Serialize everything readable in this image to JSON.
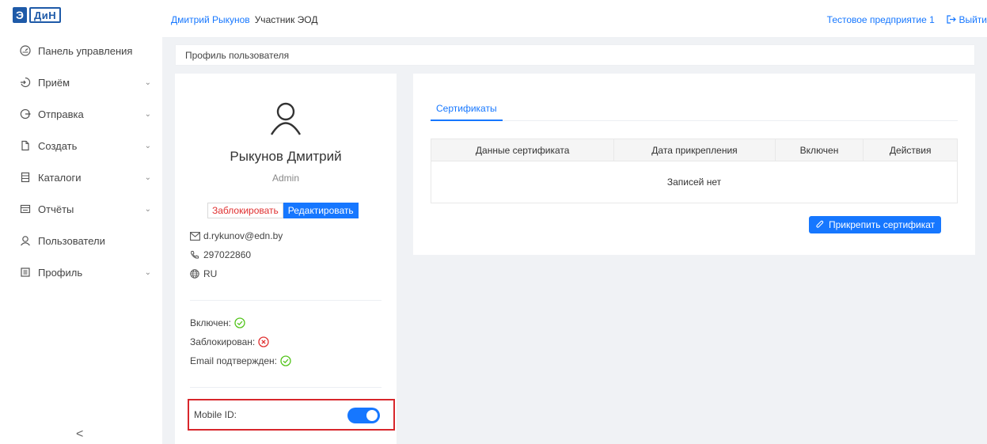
{
  "brand": {
    "logo_e": "Э",
    "logo_din": "ДиН"
  },
  "topbar": {
    "user_name": "Дмитрий Рыкунов",
    "user_role": "Участник ЭОД",
    "company": "Тестовое предприятие 1",
    "logout": "Выйти"
  },
  "sidebar": {
    "items": [
      {
        "label": "Панель управления",
        "icon": "dashboard-icon",
        "expandable": false
      },
      {
        "label": "Приём",
        "icon": "login-icon",
        "expandable": true
      },
      {
        "label": "Отправка",
        "icon": "send-icon",
        "expandable": true
      },
      {
        "label": "Создать",
        "icon": "file-icon",
        "expandable": true
      },
      {
        "label": "Каталоги",
        "icon": "catalog-icon",
        "expandable": true
      },
      {
        "label": "Отчёты",
        "icon": "report-icon",
        "expandable": true
      },
      {
        "label": "Пользователи",
        "icon": "users-icon",
        "expandable": false
      },
      {
        "label": "Профиль",
        "icon": "profile-icon",
        "expandable": true
      }
    ],
    "collapse": "<"
  },
  "breadcrumb": "Профиль пользователя",
  "profile": {
    "name": "Рыкунов Дмитрий",
    "role": "Admin",
    "block_button": "Заблокировать",
    "edit_button": "Редактировать",
    "email": "d.rykunov@edn.by",
    "phone": "297022860",
    "language": "RU",
    "enabled_label": "Включен:",
    "blocked_label": "Заблокирован:",
    "email_confirmed_label": "Email подтвержден:",
    "enabled": true,
    "blocked": false,
    "email_confirmed": true,
    "mobile_id_label": "Mobile ID:",
    "mobile_id_on": true
  },
  "certificates": {
    "tab_label": "Сертификаты",
    "columns": [
      "Данные сертификата",
      "Дата прикрепления",
      "Включен",
      "Действия"
    ],
    "empty_text": "Записей нет",
    "attach_button": "Прикрепить сертификат"
  },
  "colors": {
    "accent": "#1677ff",
    "danger": "#e03030",
    "success": "#52c41a",
    "highlight_border": "#d8262b"
  }
}
